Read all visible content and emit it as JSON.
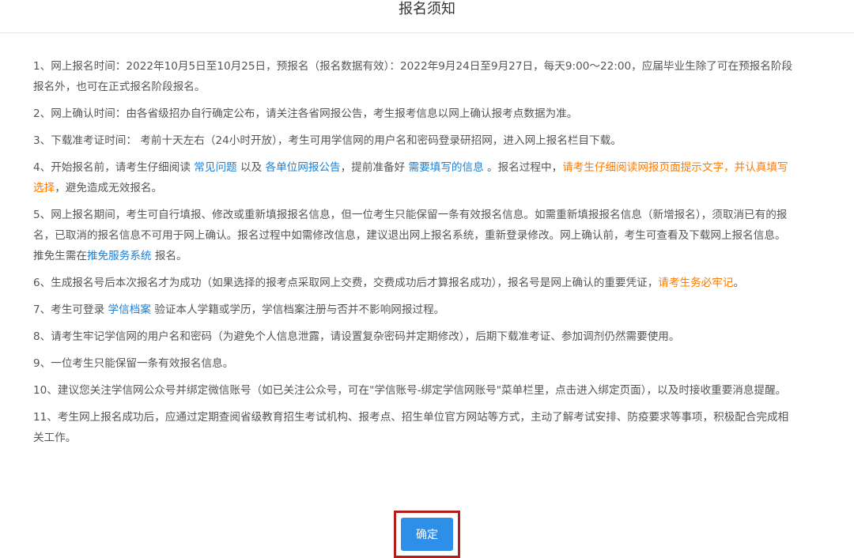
{
  "dialog": {
    "title": "报名须知",
    "confirm_label": "确定"
  },
  "colors": {
    "link": "#1a7fd4",
    "warning": "#ff7a00",
    "button": "#2d8fe8",
    "highlight_border": "#b51c1c"
  },
  "items": [
    {
      "t1": "1、网上报名时间：2022年10月5日至10月25日，预报名（报名数据有效）：2022年9月24日至9月27日，每天9:00～22:00，应届毕业生除了可在预报名阶段报名外，也可在正式报名阶段报名。"
    },
    {
      "t1": "2、网上确认时间：由各省级招办自行确定公布，请关注各省网报公告，考生报考信息以网上确认报考点数据为准。"
    },
    {
      "t1": "3、下载准考证时间： 考前十天左右（24小时开放），考生可用学信网的用户名和密码登录研招网，进入网上报名栏目下载。"
    },
    {
      "t1": "4、开始报名前，请考生仔细阅读 ",
      "link1": "常见问题",
      "t2": " 以及 ",
      "link2": "各单位网报公告",
      "t3": "，提前准备好 ",
      "link3": "需要填写的信息",
      "t4": " 。报名过程中，",
      "warn1": "请考生仔细阅读网报页面提示文字，并认真填写选择",
      "t5": "，避免造成无效报名。"
    },
    {
      "t1": "5、网上报名期间，考生可自行填报、修改或重新填报报名信息，但一位考生只能保留一条有效报名信息。如需重新填报报名信息（新增报名），须取消已有的报名，已取消的报名信息不可用于网上确认。报名过程中如需修改信息，建议退出网上报名系统，重新登录修改。网上确认前，考生可查看及下载网上报名信息。推免生需在",
      "link1": "推免服务系统",
      "t2": " 报名。"
    },
    {
      "t1": "6、生成报名号后本次报名才为成功（如果选择的报考点采取网上交费，交费成功后才算报名成功），报名号是网上确认的重要凭证，",
      "warn1": "请考生务必牢记",
      "t2": "。"
    },
    {
      "t1": "7、考生可登录 ",
      "link1": "学信档案",
      "t2": " 验证本人学籍或学历，学信档案注册与否并不影响网报过程。"
    },
    {
      "t1": "8、请考生牢记学信网的用户名和密码（为避免个人信息泄露，请设置复杂密码并定期修改），后期下载准考证、参加调剂仍然需要使用。"
    },
    {
      "t1": "9、一位考生只能保留一条有效报名信息。"
    },
    {
      "t1": "10、建议您关注学信网公众号并绑定微信账号（如已关注公众号，可在\"学信账号-绑定学信网账号\"菜单栏里，点击进入绑定页面），以及时接收重要消息提醒。"
    },
    {
      "t1": "11、考生网上报名成功后，应通过定期查阅省级教育招生考试机构、报考点、招生单位官方网站等方式，主动了解考试安排、防疫要求等事项，积极配合完成相关工作。"
    }
  ]
}
